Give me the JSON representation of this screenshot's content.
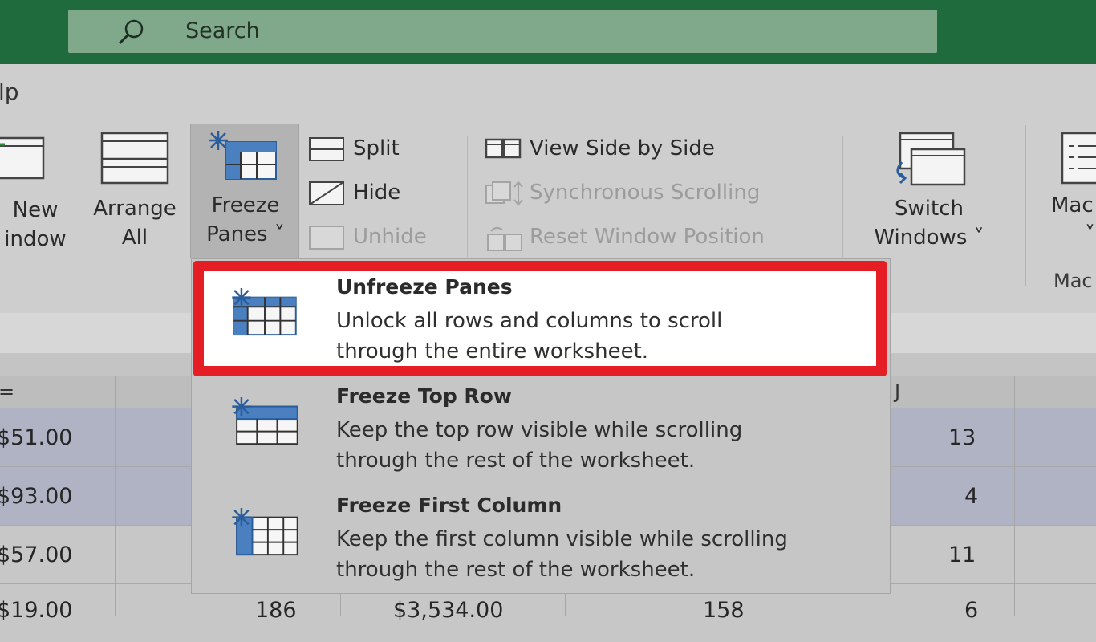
{
  "colors": {
    "titlebar": "#1f6b3d",
    "search": "#80a98c",
    "highlight_border": "#e51e25",
    "freeze_icon_blue": "#2a5d9c"
  },
  "search": {
    "label": "Search",
    "icon": "search-icon"
  },
  "ribbon": {
    "tab_partial": "lp",
    "new_window": {
      "line1": "New",
      "line2": "indow"
    },
    "arrange_all": {
      "line1": "Arrange",
      "line2": "All"
    },
    "freeze_panes": {
      "line1": "Freeze",
      "line2": "Panes ˅"
    },
    "split": "Split",
    "hide": "Hide",
    "unhide": "Unhide",
    "view_side_by_side": "View Side by Side",
    "synchronous_scrolling": "Synchronous Scrolling",
    "reset_window_position": "Reset Window Position",
    "switch_windows": {
      "line1": "Switch",
      "line2": "Windows ˅"
    },
    "macros": {
      "line1": "Mac",
      "line2": "˅",
      "group_label": "Mac"
    }
  },
  "grid": {
    "column_headers": {
      "left": "=",
      "right": "J"
    },
    "rows": [
      {
        "left": "$51.00",
        "right": "13",
        "selected": true
      },
      {
        "left": "$93.00",
        "right": "4",
        "selected": true
      },
      {
        "left": "$57.00",
        "right": "11",
        "selected": false
      },
      {
        "left": "$19.00",
        "c2": "186",
        "c3": "$3,534.00",
        "c4": "158",
        "right": "6",
        "selected": false
      }
    ]
  },
  "dropdown": {
    "items": [
      {
        "title": "Unfreeze Panes",
        "desc1": "Unlock all rows and columns to scroll",
        "desc2": "through the entire worksheet.",
        "highlighted": true
      },
      {
        "title": "Freeze Top Row",
        "desc1": "Keep the top row visible while scrolling",
        "desc2": "through the rest of the worksheet.",
        "highlighted": false
      },
      {
        "title": "Freeze First Column",
        "desc1": "Keep the first column visible while scrolling",
        "desc2": "through the rest of the worksheet.",
        "highlighted": false
      }
    ]
  }
}
